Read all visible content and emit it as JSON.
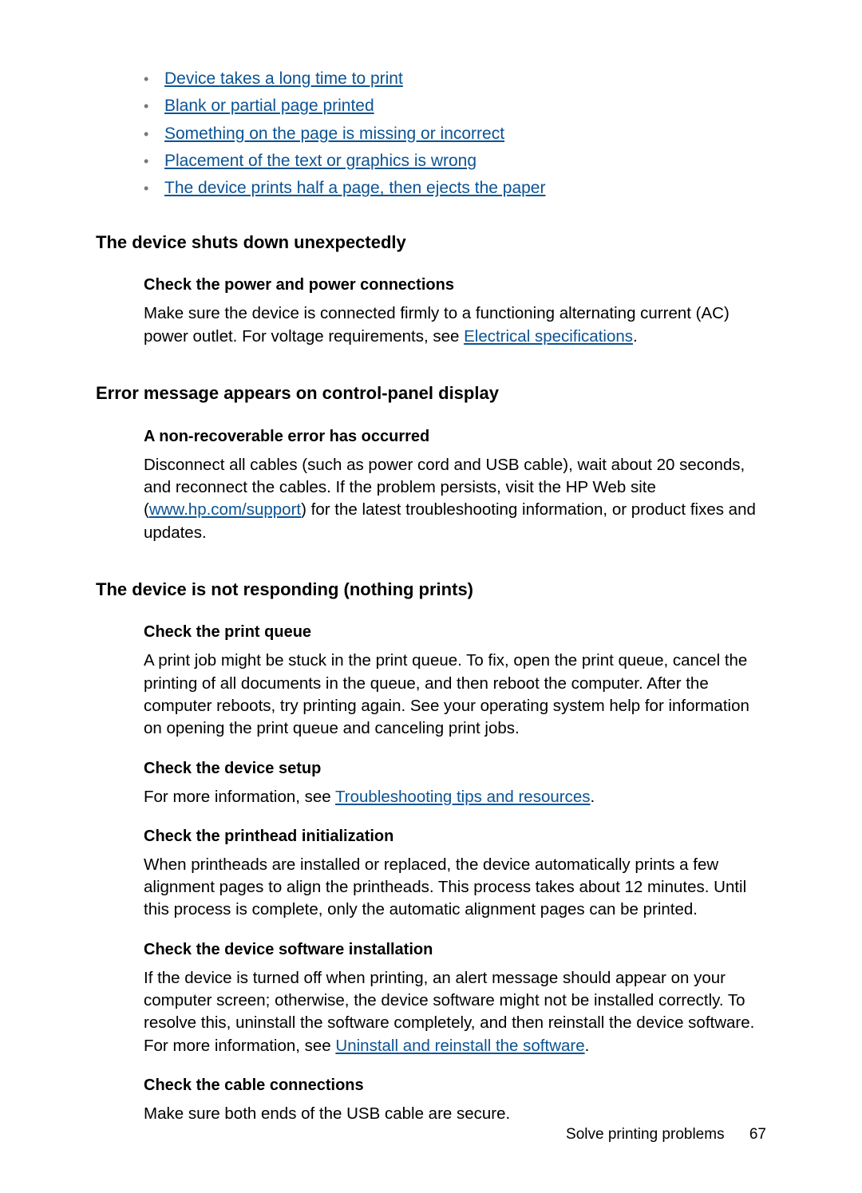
{
  "top_links": [
    "Device takes a long time to print",
    "Blank or partial page printed",
    "Something on the page is missing or incorrect",
    "Placement of the text or graphics is wrong",
    "The device prints half a page, then ejects the paper"
  ],
  "s1": {
    "heading": "The device shuts down unexpectedly",
    "sub1": "Check the power and power connections",
    "p1a": "Make sure the device is connected firmly to a functioning alternating current (AC) power outlet. For voltage requirements, see ",
    "p1link": "Electrical specifications",
    "p1b": "."
  },
  "s2": {
    "heading": "Error message appears on control-panel display",
    "sub1": "A non-recoverable error has occurred",
    "p1a": "Disconnect all cables (such as power cord and USB cable), wait about 20 seconds, and reconnect the cables. If the problem persists, visit the HP Web site (",
    "p1link": "www.hp.com/support",
    "p1b": ") for the latest troubleshooting information, or product fixes and updates."
  },
  "s3": {
    "heading": "The device is not responding (nothing prints)",
    "sub1": "Check the print queue",
    "p1": "A print job might be stuck in the print queue. To fix, open the print queue, cancel the printing of all documents in the queue, and then reboot the computer. After the computer reboots, try printing again. See your operating system help for information on opening the print queue and canceling print jobs.",
    "sub2": "Check the device setup",
    "p2a": "For more information, see ",
    "p2link": "Troubleshooting tips and resources",
    "p2b": ".",
    "sub3": "Check the printhead initialization",
    "p3": "When printheads are installed or replaced, the device automatically prints a few alignment pages to align the printheads. This process takes about 12 minutes. Until this process is complete, only the automatic alignment pages can be printed.",
    "sub4": "Check the device software installation",
    "p4a": "If the device is turned off when printing, an alert message should appear on your computer screen; otherwise, the device software might not be installed correctly. To resolve this, uninstall the software completely, and then reinstall the device software. For more information, see ",
    "p4link": "Uninstall and reinstall the software",
    "p4b": ".",
    "sub5": "Check the cable connections",
    "p5": "Make sure both ends of the USB cable are secure."
  },
  "footer": {
    "title": "Solve printing problems",
    "page": "67"
  }
}
